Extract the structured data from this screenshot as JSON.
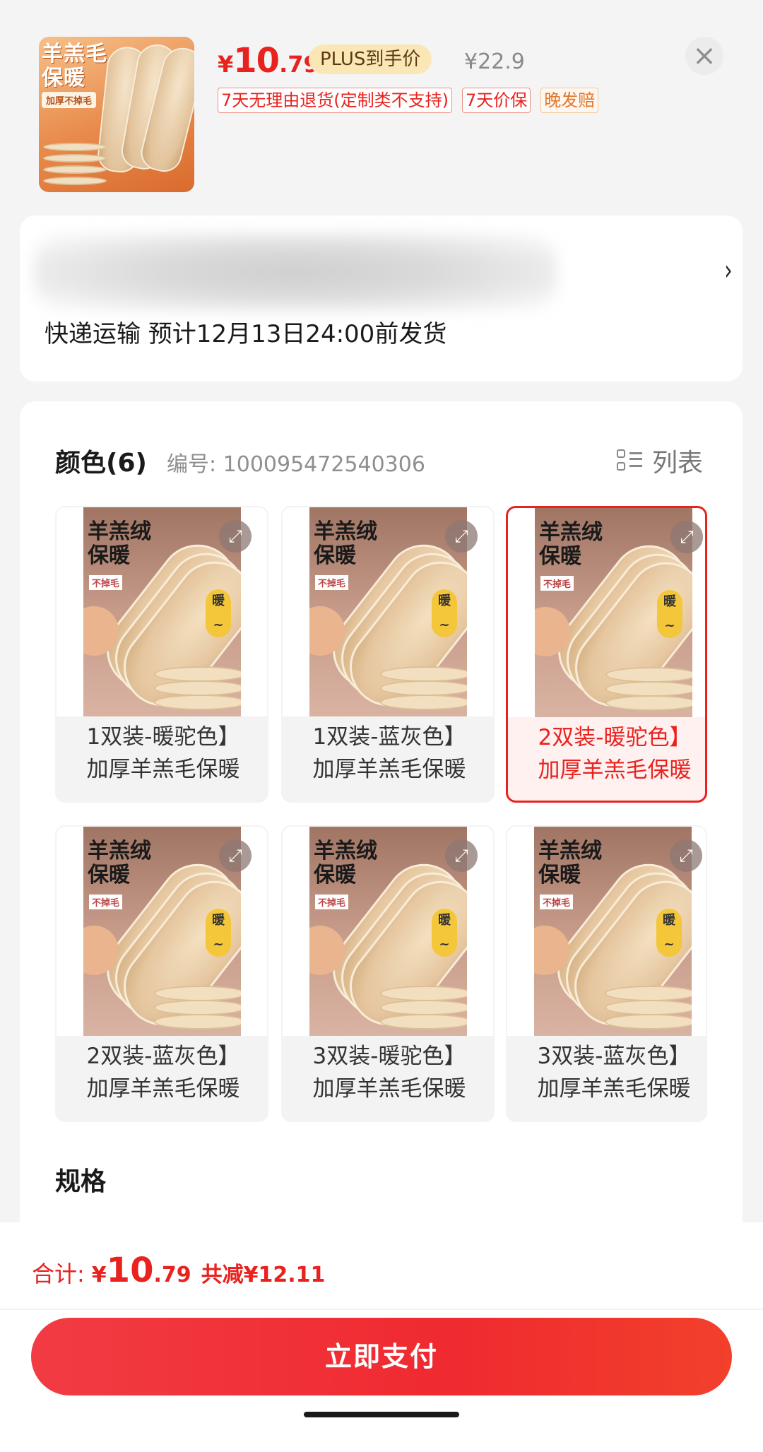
{
  "header": {
    "thumb_title": "羊羔毛\n保暖",
    "thumb_badge": "加厚不掉毛",
    "price_symbol": "¥",
    "price_int": "10",
    "price_dec": ".79",
    "plus_label": "PLUS到手价",
    "original_price": "¥22.9",
    "close_icon": "close-icon",
    "tags": [
      {
        "label": "7天无理由退货(定制类不支持)",
        "style": "red"
      },
      {
        "label": "7天价保",
        "style": "red"
      },
      {
        "label": "晚发赔",
        "style": "orange"
      }
    ]
  },
  "address": {
    "shipping_text": "快递运输 预计12月13日24:00前发货",
    "chevron": "›"
  },
  "sku": {
    "color_title": "颜色(6)",
    "code_text": "编号: 100095472540306",
    "list_label": "列表",
    "image_title": "羊羔绒\n保暖",
    "image_badge": "不掉毛",
    "image_warm": "暖\n~",
    "items": [
      {
        "line1": "1双装-暖驼色】",
        "line2": "加厚羊羔毛保暖",
        "selected": false
      },
      {
        "line1": "1双装-蓝灰色】",
        "line2": "加厚羊羔毛保暖",
        "selected": false
      },
      {
        "line1": "2双装-暖驼色】",
        "line2": "加厚羊羔毛保暖",
        "selected": true
      },
      {
        "line1": "2双装-蓝灰色】",
        "line2": "加厚羊羔毛保暖",
        "selected": false
      },
      {
        "line1": "3双装-暖驼色】",
        "line2": "加厚羊羔毛保暖",
        "selected": false
      },
      {
        "line1": "3双装-蓝灰色】",
        "line2": "加厚羊羔毛保暖",
        "selected": false
      }
    ],
    "spec_title": "规格"
  },
  "footer": {
    "total_label": "合计:",
    "total_symbol": "¥",
    "total_int": "10",
    "total_dec": ".79",
    "total_save": "共减¥12.11",
    "pay_label": "立即支付"
  },
  "colors": {
    "accent": "#e8231f",
    "plus_bg": "#fbe7b6",
    "selected_bg": "#fff1f0"
  }
}
